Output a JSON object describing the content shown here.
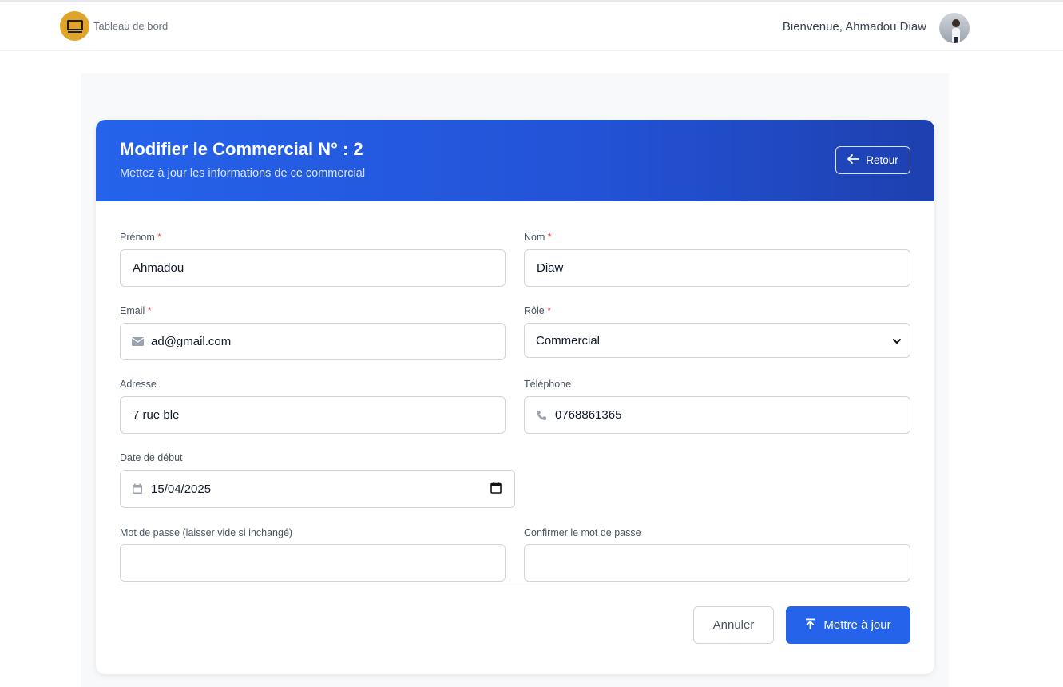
{
  "topbar": {
    "logo_text": "Tableau de bord",
    "welcome": "Bienvenue, Ahmadou Diaw"
  },
  "header": {
    "title": "Modifier le Commercial N° : 2",
    "subtitle": "Mettez à jour les informations de ce commercial",
    "back_label": "Retour"
  },
  "form": {
    "prenom": {
      "label": "Prénom",
      "required": "*",
      "value": "Ahmadou"
    },
    "nom": {
      "label": "Nom",
      "required": "*",
      "value": "Diaw"
    },
    "email": {
      "label": "Email",
      "required": "*",
      "value": "ad@gmail.com",
      "icon": "envelope-icon"
    },
    "role": {
      "label": "Rôle",
      "required": "*",
      "value": "Commercial"
    },
    "adresse": {
      "label": "Adresse",
      "value": "7 rue ble"
    },
    "telephone": {
      "label": "Téléphone",
      "value": "0768861365",
      "icon": "phone-icon"
    },
    "date_debut": {
      "label": "Date de début",
      "value": "15/04/2025",
      "icon": "calendar-icon"
    },
    "password": {
      "label": "Mot de passe (laisser vide si inchangé)",
      "value": ""
    },
    "password_confirm": {
      "label": "Confirmer le mot de passe",
      "value": ""
    }
  },
  "actions": {
    "cancel_label": "Annuler",
    "submit_label": "Mettre à jour"
  },
  "colors": {
    "primary": "#2563eb",
    "header_gradient_end": "#1e40af",
    "required": "#ef4444",
    "logo_bg": "#e0a42a"
  }
}
